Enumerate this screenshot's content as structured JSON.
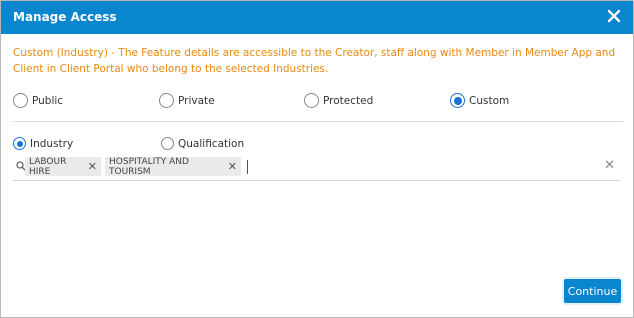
{
  "dialog": {
    "title": "Manage Access",
    "description": "Custom (Industry) - The Feature details are accessible to the Creator, staff along with Member in Member App and Client in Client Portal who belong to the selected Industries."
  },
  "access_options": [
    {
      "label": "Public",
      "checked": false
    },
    {
      "label": "Private",
      "checked": false
    },
    {
      "label": "Protected",
      "checked": false
    },
    {
      "label": "Custom",
      "checked": true
    }
  ],
  "filter_options": [
    {
      "label": "Industry",
      "checked": true
    },
    {
      "label": "Qualification",
      "checked": false
    }
  ],
  "tags": [
    {
      "label": "LABOUR HIRE"
    },
    {
      "label": "HOSPITALITY AND TOURISM"
    }
  ],
  "actions": {
    "continue_label": "Continue"
  },
  "colors": {
    "accent": "#0a86cf",
    "warning_text": "#e8890f"
  },
  "icons": {
    "close": "close-icon",
    "search": "search-icon",
    "clear": "clear-icon"
  }
}
